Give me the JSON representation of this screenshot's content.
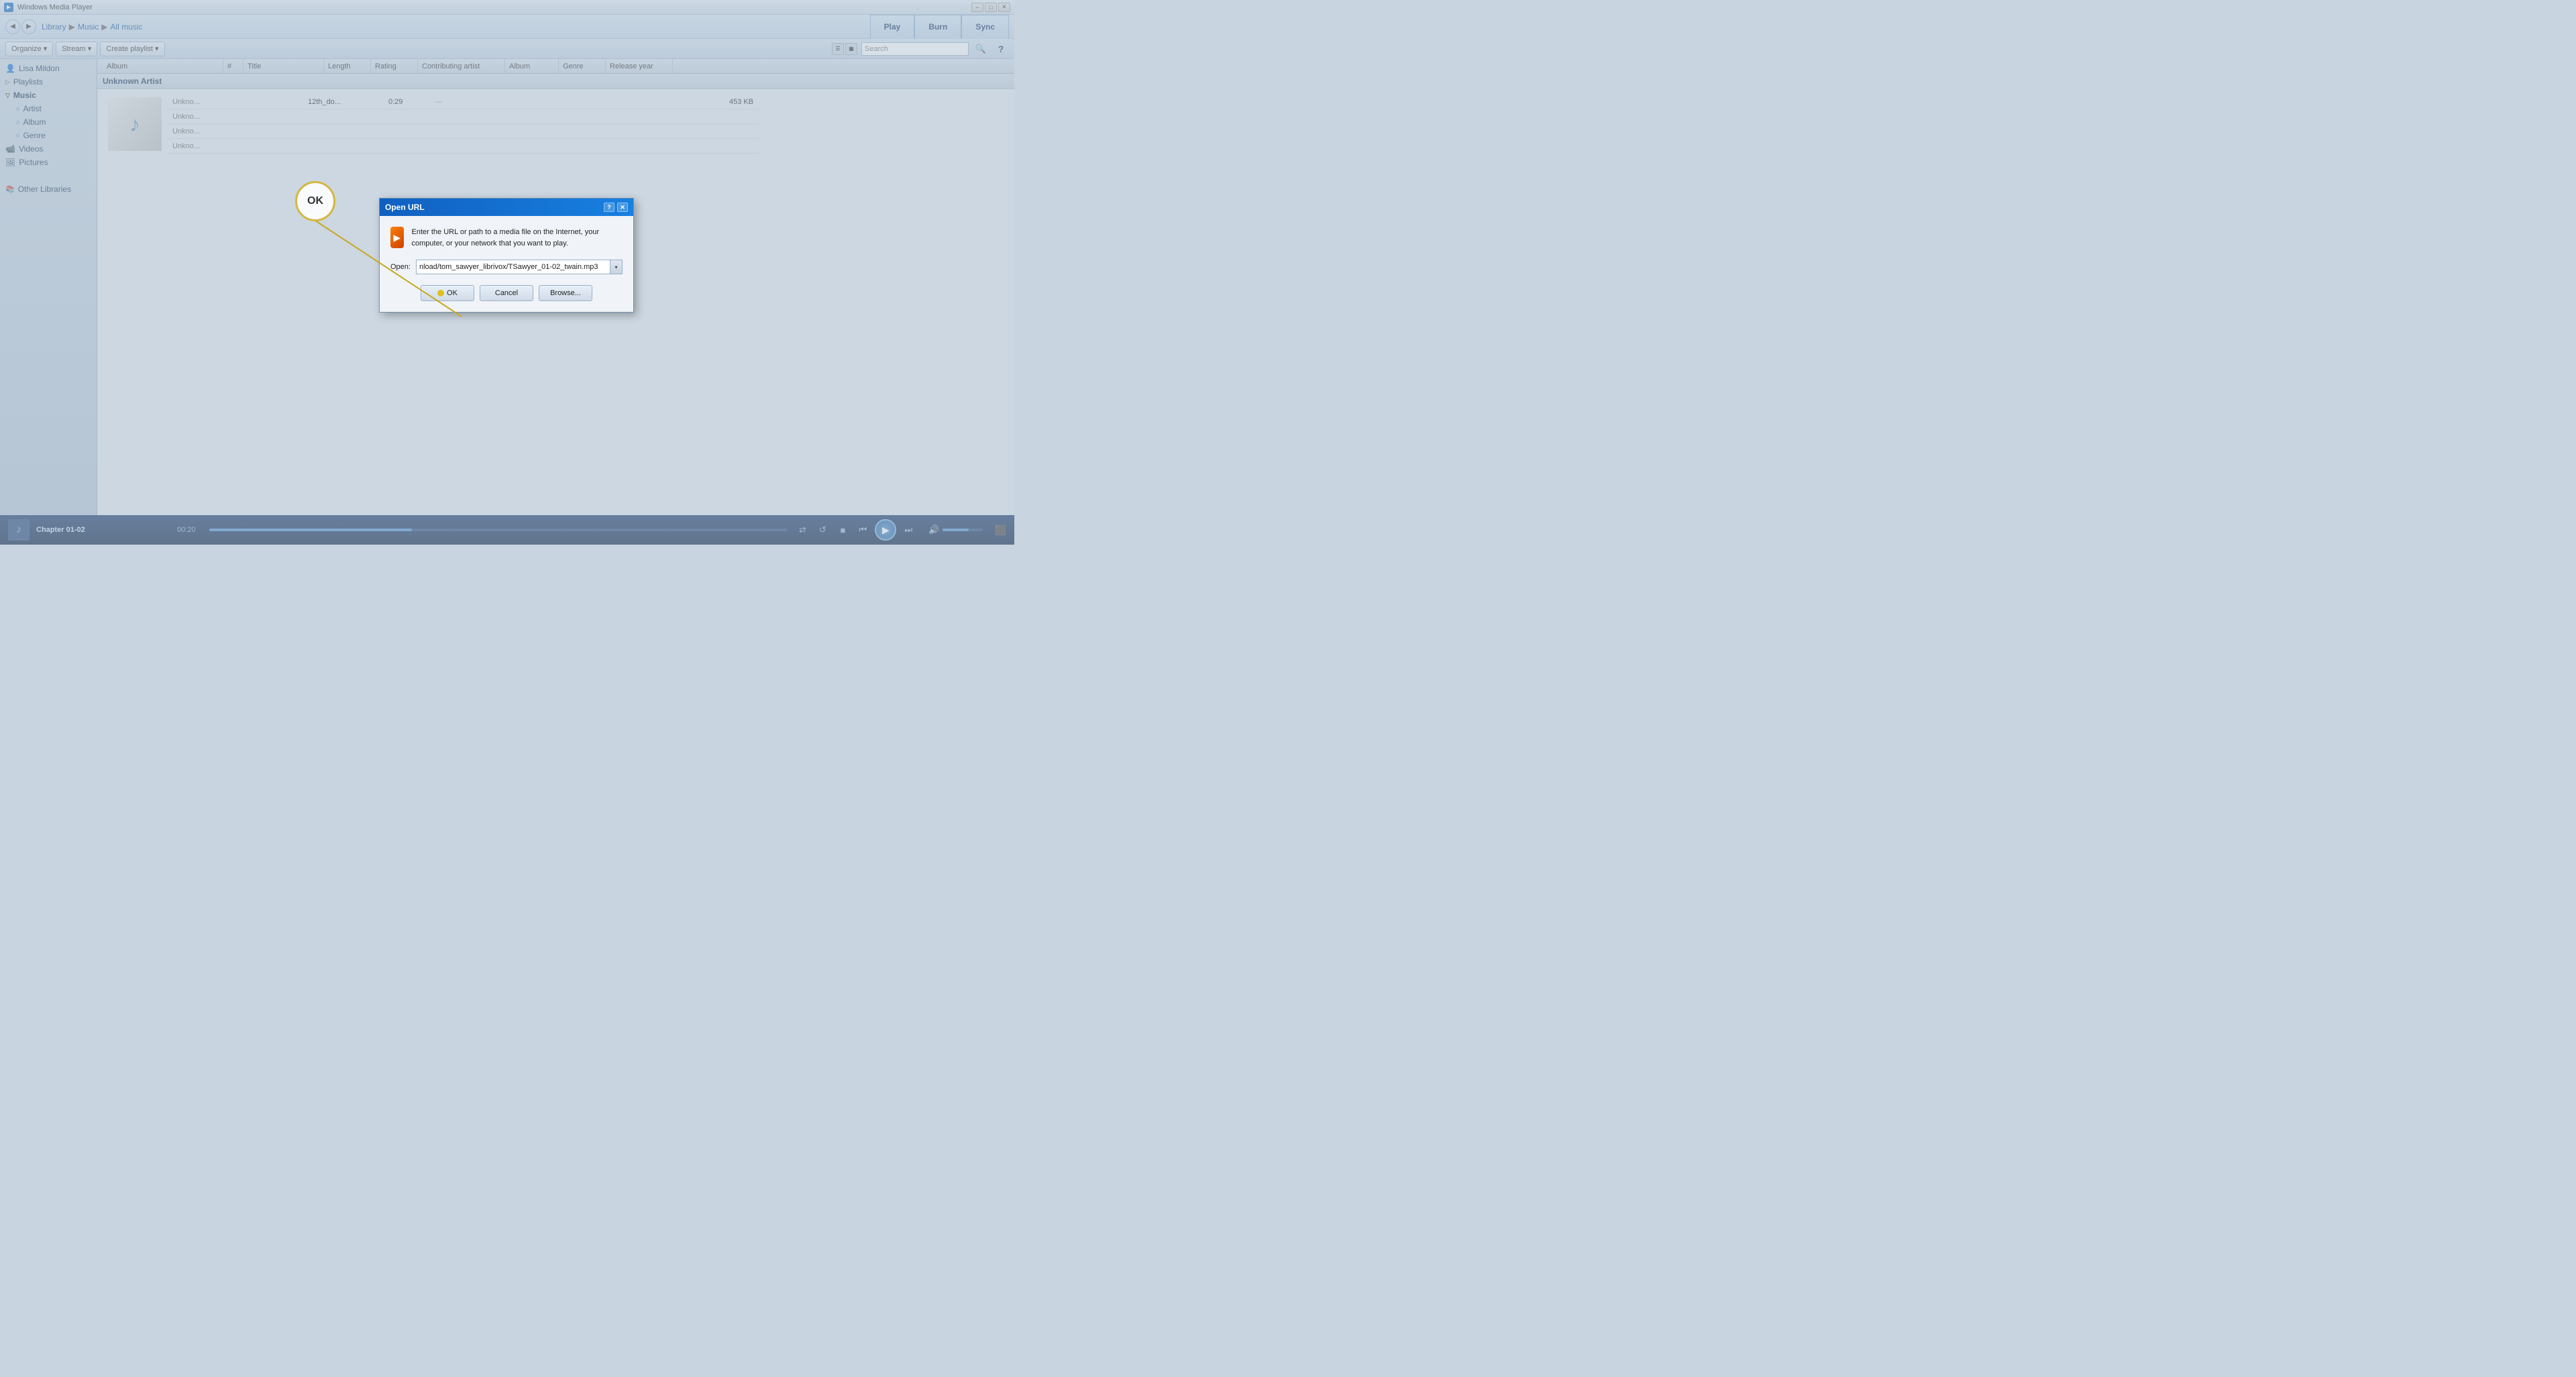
{
  "app": {
    "title": "Windows Media Player"
  },
  "titlebar": {
    "title": "Windows Media Player",
    "minimize": "−",
    "restore": "□",
    "close": "✕"
  },
  "navbar": {
    "back_label": "◀",
    "forward_label": "▶",
    "breadcrumb": [
      "Library",
      "Music",
      "All music"
    ],
    "tab_play": "Play",
    "tab_burn": "Burn",
    "tab_sync": "Sync"
  },
  "toolbar": {
    "organize_label": "Organize ▾",
    "stream_label": "Stream ▾",
    "create_playlist_label": "Create playlist ▾",
    "search_placeholder": "Search"
  },
  "columns": {
    "album": "Album",
    "number": "#",
    "title": "Title",
    "length": "Length",
    "rating": "Rating",
    "contributing_artist": "Contributing artist",
    "album2": "Album",
    "genre": "Genre",
    "release_year": "Release year"
  },
  "sidebar": {
    "user": "Lisa Mildon",
    "items": [
      {
        "label": "Playlists",
        "icon": "🎵",
        "expandable": true,
        "indent": 0
      },
      {
        "label": "Music",
        "icon": "🎵",
        "expandable": true,
        "indent": 0,
        "expanded": true
      },
      {
        "label": "Artist",
        "icon": "○",
        "expandable": false,
        "indent": 1
      },
      {
        "label": "Album",
        "icon": "○",
        "expandable": false,
        "indent": 1
      },
      {
        "label": "Genre",
        "icon": "○",
        "expandable": false,
        "indent": 1
      },
      {
        "label": "Videos",
        "icon": "📹",
        "expandable": false,
        "indent": 0
      },
      {
        "label": "Pictures",
        "icon": "🖼",
        "expandable": false,
        "indent": 0
      },
      {
        "label": "Other Libraries",
        "icon": "📚",
        "expandable": false,
        "indent": 0
      }
    ]
  },
  "content": {
    "group_header": "Unknown Artist",
    "tracks": [
      {
        "album_display": "Unkno...",
        "number": "",
        "title": "12th_do...",
        "length": "0:29",
        "rating": "---",
        "contributing_artist": "",
        "album": "",
        "genre": "",
        "release_year": "",
        "size": "453 KB"
      },
      {
        "album_display": "Unkno...",
        "number": "",
        "title": "",
        "length": "",
        "rating": "",
        "contributing_artist": "",
        "album": "",
        "genre": "",
        "release_year": "",
        "size": ""
      },
      {
        "album_display": "Unkno...",
        "number": "",
        "title": "",
        "length": "",
        "rating": "",
        "contributing_artist": "",
        "album": "",
        "genre": "",
        "release_year": "",
        "size": ""
      },
      {
        "album_display": "Unkno...",
        "number": "",
        "title": "",
        "length": "",
        "rating": "",
        "contributing_artist": "",
        "album": "",
        "genre": "",
        "release_year": "",
        "size": ""
      }
    ]
  },
  "player": {
    "track_name": "Chapter 01-02",
    "time": "00:20",
    "progress_percent": 30,
    "controls": {
      "shuffle": "⇄",
      "repeat": "↺",
      "stop": "■",
      "prev": "⏮",
      "play": "▶",
      "next": "⏭",
      "volume_icon": "🔊"
    }
  },
  "dialog": {
    "title": "Open URL",
    "help_btn": "?",
    "close_btn": "✕",
    "message": "Enter the URL or path to a media file on the Internet, your computer, or your network that you want to play.",
    "open_label": "Open:",
    "url_value": "nload/tom_sawyer_librivox/TSawyer_01-02_twain.mp3",
    "ok_label": "OK",
    "cancel_label": "Cancel",
    "browse_label": "Browse..."
  },
  "annotation": {
    "ok_label": "OK"
  },
  "colors": {
    "dialog_titlebar": "#1060c0",
    "sidebar_bg": "#c8d4e0",
    "content_bg": "#e4eaf0",
    "player_bg": "#1a3a6a",
    "accent": "#5090d0"
  }
}
